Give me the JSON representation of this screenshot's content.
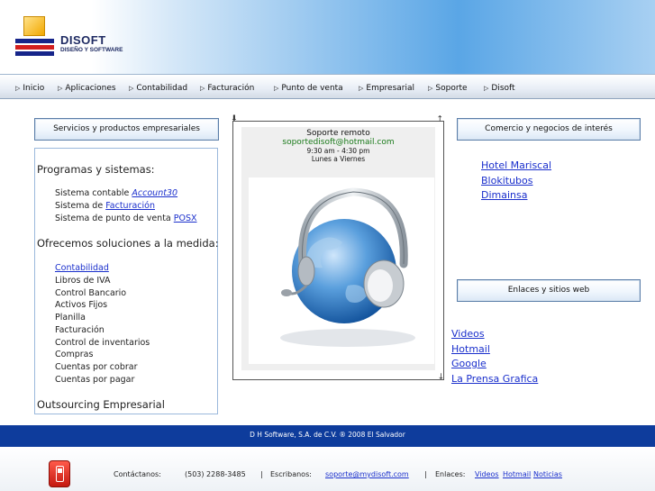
{
  "brand": {
    "name": "DISOFT",
    "tagline": "DISEÑO Y SOFTWARE"
  },
  "nav": [
    {
      "label": "Inicio"
    },
    {
      "label": "Aplicaciones"
    },
    {
      "label": "Contabilidad"
    },
    {
      "label": "Facturación"
    },
    {
      "label": "Punto de venta"
    },
    {
      "label": "Empresarial"
    },
    {
      "label": "Soporte"
    },
    {
      "label": "Disoft"
    }
  ],
  "left_panel": {
    "title": "Servicios y productos empresariales",
    "section1": "Programas y sistemas:",
    "programs": [
      {
        "text": "Sistema contable ",
        "link": "Account30"
      },
      {
        "text": "Sistema de ",
        "link": "Facturación"
      },
      {
        "text": "Sistema de punto de venta ",
        "link": "POSX"
      }
    ],
    "section2": "Ofrecemos soluciones a la medida:",
    "solutions_link": "Contabilidad",
    "solutions": [
      "Libros de IVA",
      "Control Bancario",
      "Activos Fijos",
      "Planilla",
      "Facturación",
      "Control de inventarios",
      "Compras",
      "Cuentas por cobrar",
      "Cuentas por pagar"
    ],
    "section3": "Outsourcing Empresarial"
  },
  "support": {
    "title": "Soporte remoto",
    "email": "soportedisoft@hotmail.com",
    "hours": "9:30 am  - 4:30 pm",
    "days": "Lunes a Viernes"
  },
  "commerce": {
    "title": "Comercio y negocios de interés",
    "links": [
      "Hotel Mariscal",
      "Blokitubos",
      "Dimainsa"
    ]
  },
  "web_links": {
    "title": "Enlaces y sitios web",
    "links": [
      "Videos",
      "Hotmail",
      "Google",
      "La Prensa Grafica"
    ]
  },
  "footer": {
    "copyright": "D H Software, S.A. de C.V.  ® 2008    El Salvador",
    "contact_label": "Contáctanos:",
    "phone": "(503) 2288-3485",
    "sep": "|",
    "write_label": "Escribanos:",
    "email": "soporte@mydisoft.com",
    "links_label": "Enlaces:",
    "links": [
      "Videos",
      "Hotmail",
      "Noticias"
    ]
  },
  "colors": {
    "nav_bg": "#e8eef6",
    "footer_bar": "#0e3c9c",
    "link": "#1a2fcc",
    "support_email": "#1a7a1a"
  }
}
